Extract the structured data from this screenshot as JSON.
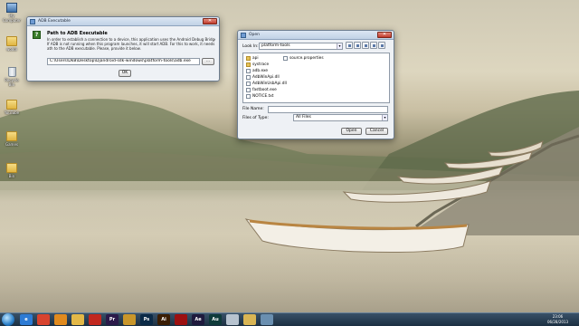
{
  "desktop": {
    "icons": [
      {
        "label": "My Computer",
        "type": "computer-icon"
      },
      {
        "label": "wodol",
        "type": "folder-icon"
      },
      {
        "label": "Recycle Bin",
        "type": "recycle-bin-icon"
      },
      {
        "label": "YouTube",
        "type": "folder-icon"
      },
      {
        "label": "Games",
        "type": "folder-icon"
      },
      {
        "label": "Bin",
        "type": "folder-icon"
      }
    ]
  },
  "adb_dialog": {
    "title": "ADB Executable",
    "heading": "Path to ADB Executable",
    "description": [
      "In order to establish a connection to a device, this application uses the Android Debug Bridge (ADB).",
      "If ADB is not running when this program launches, it will start ADB. For this to work, it needs the full p",
      "ath to the ADB executable. Please, provide it below."
    ],
    "path_value": "C:\\Users\\DkB\\Desktop\\Djandroid-sdk-windows\\platform-tools\\adb.exe",
    "browse_label": "...",
    "ok_label": "OK"
  },
  "open_dialog": {
    "title": "Open",
    "look_in_label": "Look In:",
    "look_in_value": "platform-tools",
    "files": [
      {
        "name": "api",
        "kind": "folder"
      },
      {
        "name": "systrace",
        "kind": "folder"
      },
      {
        "name": "adb.exe",
        "kind": "file"
      },
      {
        "name": "AdbWinApi.dll",
        "kind": "file"
      },
      {
        "name": "AdbWinUsbApi.dll",
        "kind": "file"
      },
      {
        "name": "fastboot.exe",
        "kind": "file"
      },
      {
        "name": "NOTICE.txt",
        "kind": "file"
      },
      {
        "name": "source.properties",
        "kind": "file"
      }
    ],
    "file_name_label": "File Name:",
    "file_name_value": "",
    "files_of_type_label": "Files of Type:",
    "files_of_type_value": "All Files",
    "open_label": "Open",
    "cancel_label": "Cancel"
  },
  "taskbar": {
    "apps": [
      {
        "name": "internet-explorer-icon",
        "text": "e",
        "color": "#2d7bd4"
      },
      {
        "name": "chrome-icon",
        "text": "",
        "color": "#d8432f"
      },
      {
        "name": "media-player-icon",
        "text": "",
        "color": "#e08a1e"
      },
      {
        "name": "explorer-icon",
        "text": "",
        "color": "#e3b847"
      },
      {
        "name": "app-red-icon",
        "text": "",
        "color": "#c2271f"
      },
      {
        "name": "premiere-icon",
        "text": "Pr",
        "color": "#2b1a4a"
      },
      {
        "name": "app-game-icon",
        "text": "",
        "color": "#c9962a"
      },
      {
        "name": "photoshop-icon",
        "text": "Ps",
        "color": "#0b2a47"
      },
      {
        "name": "illustrator-icon",
        "text": "Ai",
        "color": "#3a1d04"
      },
      {
        "name": "acrobat-icon",
        "text": "",
        "color": "#9c1010"
      },
      {
        "name": "after-effects-icon",
        "text": "Ae",
        "color": "#1f1a3d"
      },
      {
        "name": "audition-icon",
        "text": "Au",
        "color": "#0f3b3a"
      },
      {
        "name": "java-app-icon",
        "text": "",
        "color": "#b7c3cf"
      },
      {
        "name": "folder-app-icon",
        "text": "",
        "color": "#d9b554"
      },
      {
        "name": "network-app-icon",
        "text": "",
        "color": "#6a8fb0"
      }
    ],
    "clock_time": "23:06",
    "clock_date": "06/28/2013"
  }
}
